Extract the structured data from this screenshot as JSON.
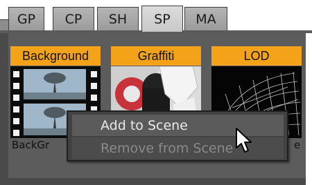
{
  "tabs": [
    {
      "label": "GP",
      "active": false
    },
    {
      "label": "CP",
      "active": false
    },
    {
      "label": "SH",
      "active": false
    },
    {
      "label": "SP",
      "active": true
    },
    {
      "label": "MA",
      "active": false
    }
  ],
  "items": [
    {
      "title": "Background",
      "caption": "BackGr"
    },
    {
      "title": "Graffiti",
      "caption": ""
    },
    {
      "title": "LOD",
      "caption": "e"
    }
  ],
  "context_menu": {
    "add_label": "Add to Scene",
    "remove_label": "Remove from Scene",
    "remove_enabled": false
  },
  "colors": {
    "title_bg": "#f4a21a",
    "panel_bg": "#5c5c5c",
    "menu_bg": "#424242"
  }
}
